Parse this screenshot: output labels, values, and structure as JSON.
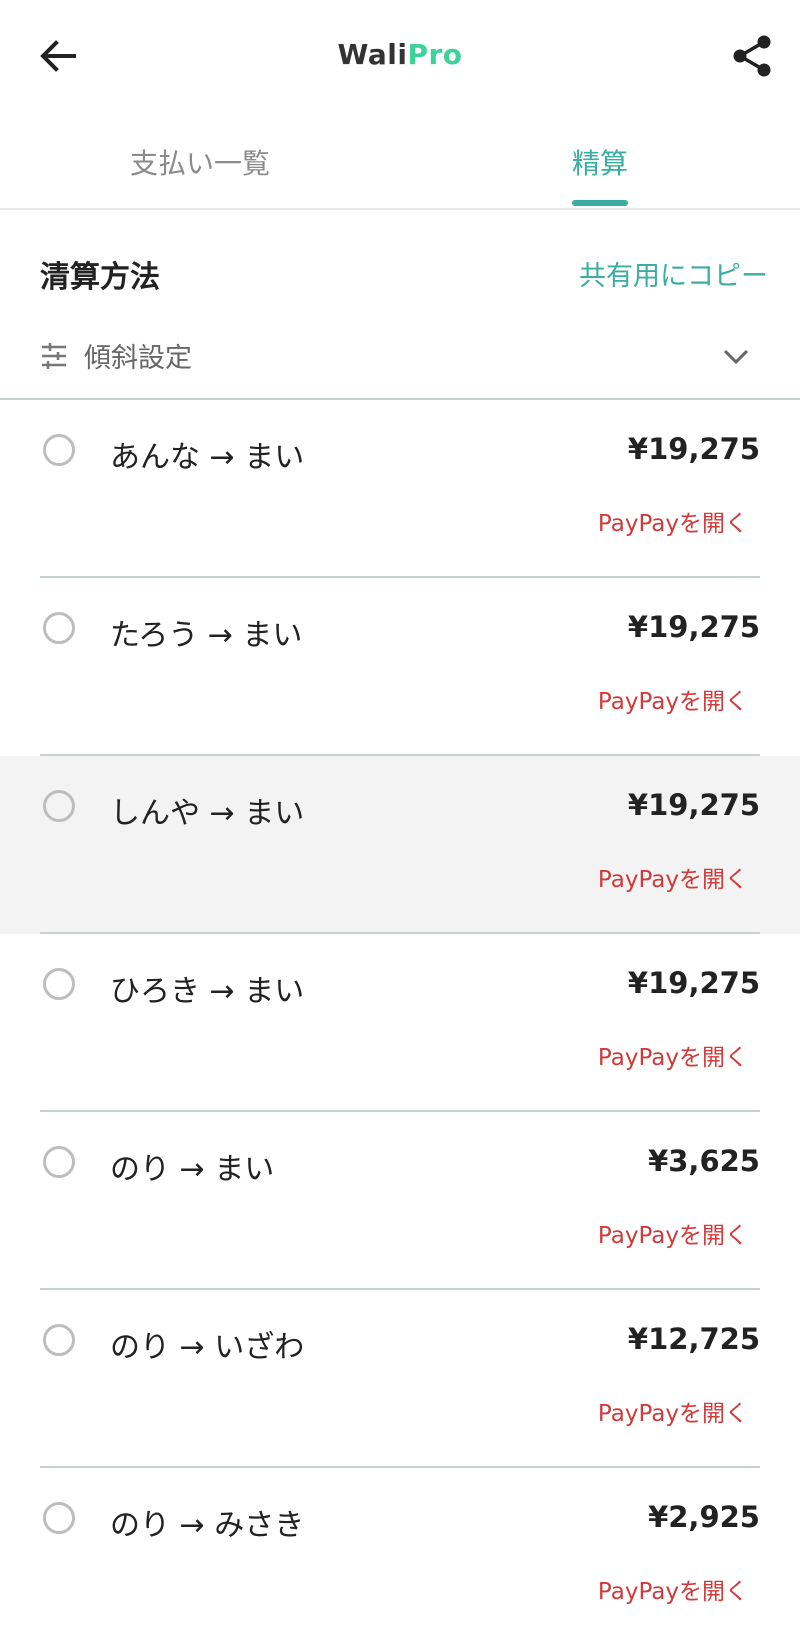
{
  "app": {
    "logo_main": "Wali",
    "logo_accent": "Pro"
  },
  "header": {
    "back_icon": "arrow-left-icon",
    "share_icon": "share-icon"
  },
  "tabs": [
    {
      "label": "支払い一覧",
      "active": false
    },
    {
      "label": "精算",
      "active": true
    }
  ],
  "section": {
    "title": "清算方法",
    "copy_label": "共有用にコピー"
  },
  "tilt": {
    "label": "傾斜設定",
    "icon": "sliders-icon",
    "chevron": "chevron-down-icon"
  },
  "settlements": [
    {
      "from_to": "あんな → まい",
      "amount": "¥19,275",
      "action": "PayPayを開く",
      "checked": false
    },
    {
      "from_to": "たろう → まい",
      "amount": "¥19,275",
      "action": "PayPayを開く",
      "checked": false
    },
    {
      "from_to": "しんや → まい",
      "amount": "¥19,275",
      "action": "PayPayを開く",
      "checked": false
    },
    {
      "from_to": "ひろき → まい",
      "amount": "¥19,275",
      "action": "PayPayを開く",
      "checked": false
    },
    {
      "from_to": "のり → まい",
      "amount": "¥3,625",
      "action": "PayPayを開く",
      "checked": false
    },
    {
      "from_to": "のり → いざわ",
      "amount": "¥12,725",
      "action": "PayPayを開く",
      "checked": false
    },
    {
      "from_to": "のり → みさき",
      "amount": "¥2,925",
      "action": "PayPayを開く",
      "checked": false
    }
  ],
  "colors": {
    "accent": "#3aaea0",
    "logo_green": "#3cd29a",
    "paypay_red": "#d03a3a",
    "row_highlight": "#f3f3f3"
  }
}
